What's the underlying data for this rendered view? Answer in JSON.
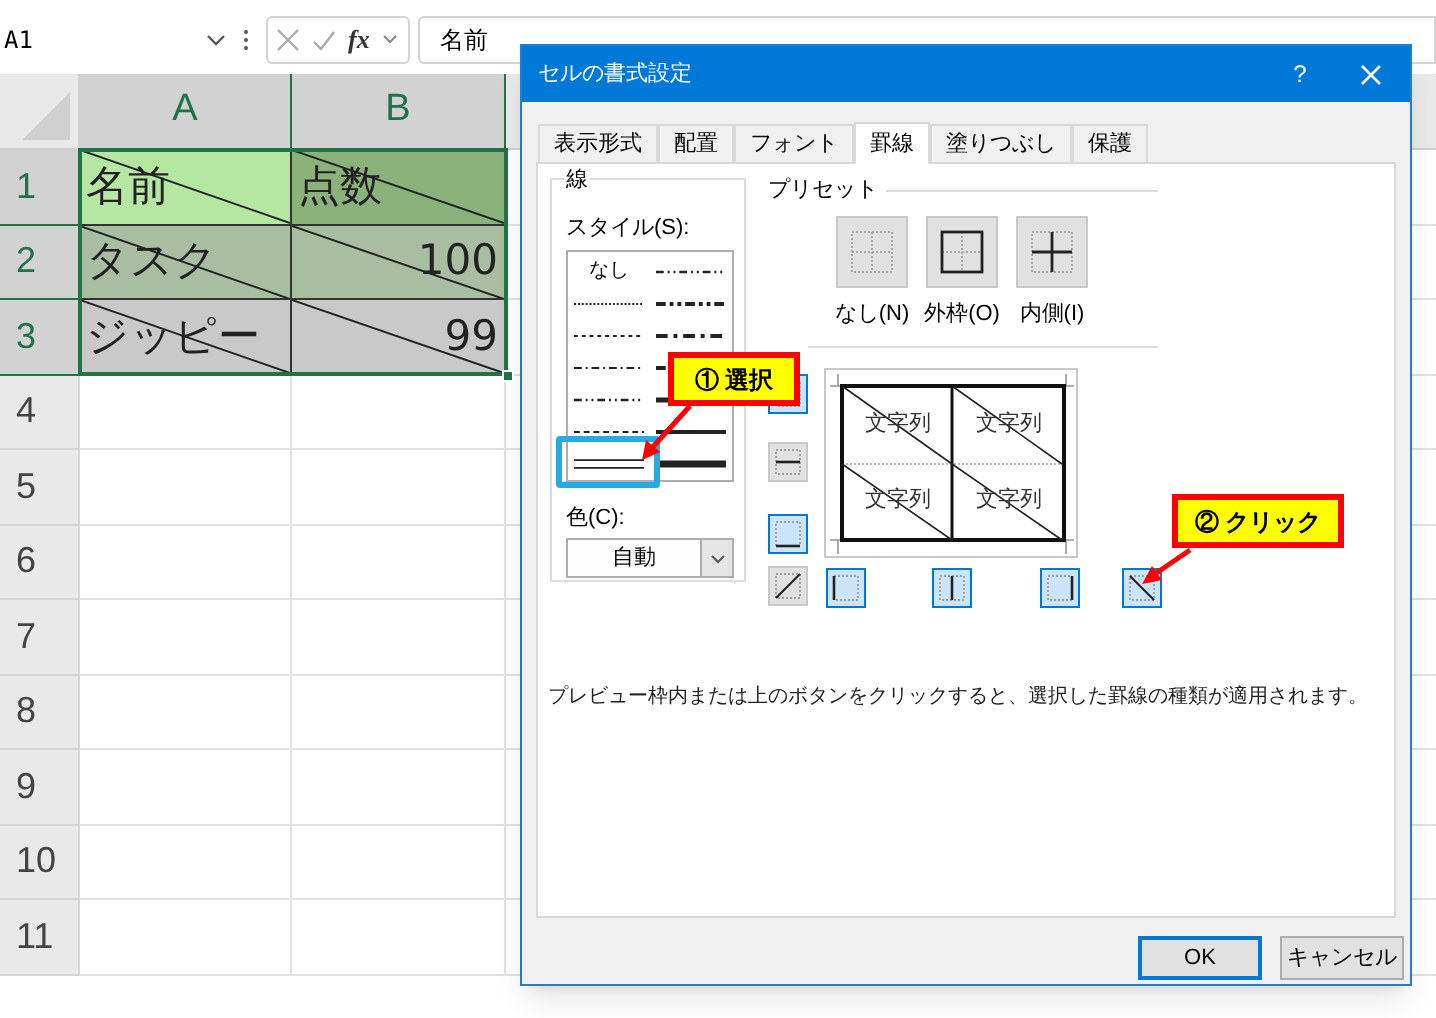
{
  "formula_bar": {
    "name_box": "A1",
    "function_label": "fx",
    "value": "名前"
  },
  "sheet": {
    "columns": [
      {
        "label": "A",
        "selected": true
      },
      {
        "label": "B",
        "selected": true
      }
    ],
    "rows": [
      {
        "label": "1",
        "selected": true,
        "cells": [
          {
            "text": "名前",
            "kind": "text",
            "color": "#b5e6a2"
          },
          {
            "text": "点数",
            "kind": "text",
            "color": "#8bb27b"
          }
        ]
      },
      {
        "label": "2",
        "selected": true,
        "cells": [
          {
            "text": "タスク",
            "kind": "text",
            "color": "#a9bea1"
          },
          {
            "text": "100",
            "kind": "number",
            "color": "#a9bea1"
          }
        ]
      },
      {
        "label": "3",
        "selected": true,
        "cells": [
          {
            "text": "ジッピー",
            "kind": "text",
            "color": "#c9c9c9"
          },
          {
            "text": "99",
            "kind": "number",
            "color": "#c9c9c9"
          }
        ]
      },
      {
        "label": "4",
        "selected": false,
        "cells": []
      },
      {
        "label": "5",
        "selected": false,
        "cells": []
      },
      {
        "label": "6",
        "selected": false,
        "cells": []
      },
      {
        "label": "7",
        "selected": false,
        "cells": []
      },
      {
        "label": "8",
        "selected": false,
        "cells": []
      },
      {
        "label": "9",
        "selected": false,
        "cells": []
      },
      {
        "label": "10",
        "selected": false,
        "cells": []
      },
      {
        "label": "11",
        "selected": false,
        "cells": []
      }
    ]
  },
  "dialog": {
    "title": "セルの書式設定",
    "help": "?",
    "tabs": [
      {
        "label": "表示形式",
        "selected": false
      },
      {
        "label": "配置",
        "selected": false
      },
      {
        "label": "フォント",
        "selected": false
      },
      {
        "label": "罫線",
        "selected": true
      },
      {
        "label": "塗りつぶし",
        "selected": false
      },
      {
        "label": "保護",
        "selected": false
      }
    ],
    "line_group": {
      "title": "線",
      "style_label": "スタイル(S):",
      "styles": [
        {
          "kind": "none",
          "label": "なし"
        },
        {
          "kind": "dash_dot_dot"
        },
        {
          "kind": "hair"
        },
        {
          "kind": "medium_dash_dot_dot"
        },
        {
          "kind": "dotted"
        },
        {
          "kind": "medium_dash_dot"
        },
        {
          "kind": "dash_dot"
        },
        {
          "kind": "medium_dashed"
        },
        {
          "kind": "dash_dot_dot"
        },
        {
          "kind": "thick"
        },
        {
          "kind": "dashed"
        },
        {
          "kind": "medium"
        },
        {
          "kind": "double"
        },
        {
          "kind": "thick2"
        }
      ],
      "color_label": "色(C):",
      "color_value": "自動"
    },
    "preset": {
      "title": "プリセット",
      "buttons": [
        {
          "kind": "none",
          "label": "なし(N)"
        },
        {
          "kind": "outline",
          "label": "外枠(O)"
        },
        {
          "kind": "inside",
          "label": "内側(I)"
        }
      ]
    },
    "border": {
      "left_buttons": [
        {
          "kind": "top",
          "selected": true
        },
        {
          "kind": "middle_h",
          "selected": false
        },
        {
          "kind": "bottom",
          "selected": true
        },
        {
          "kind": "diag_up",
          "selected": false
        }
      ],
      "bottom_buttons": [
        {
          "kind": "left",
          "selected": true
        },
        {
          "kind": "middle_v",
          "selected": true
        },
        {
          "kind": "right",
          "selected": true
        },
        {
          "kind": "diag_down",
          "selected": true
        }
      ],
      "preview_texts": [
        "文字列",
        "文字列",
        "文字列",
        "文字列"
      ]
    },
    "description": "プレビュー枠内または上のボタンをクリックすると、選択した罫線の種類が適用されます。",
    "buttons": [
      {
        "label": "OK",
        "default": true
      },
      {
        "label": "キャンセル",
        "default": false
      }
    ]
  },
  "callouts": [
    {
      "label": "① 選択"
    },
    {
      "label": "② クリック"
    }
  ]
}
